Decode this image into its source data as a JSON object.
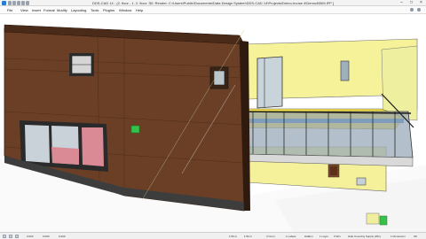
{
  "window": {
    "title": "DDS-CAD 14 - (2. floor - 1. 2. floor: 3D: Render: C:\\Users\\Public\\Documents\\Data Design System\\DDS-CAD 14\\Projects\\Demo-house 4\\Demo4\\BIM.IFP ]"
  },
  "menu": {
    "items": [
      "File",
      "View",
      "Insert",
      "Format",
      "Modify",
      "Layouting",
      "Tools",
      "Plugins",
      "Window",
      "Help"
    ]
  },
  "status": {
    "left": [
      "0.000",
      "0.000",
      "0.000"
    ],
    "mid": [
      "1:50 m",
      "1:50 m",
      "3 Cmm",
      "1 Labels",
      "Hidden",
      "1 Layer",
      "0 Wm"
    ],
    "right": "Hide Covering Supply (Wm)",
    "far_right": [
      "1 Dimension",
      "3D"
    ]
  },
  "colors": {
    "facade_brown": "#6b3f26",
    "facade_light": "#f4f19a",
    "accent_blue": "#2a7bd4",
    "rail_glass": "#8fa1b3",
    "floor_pink": "#d98a95",
    "marker_green": "#34c24a"
  }
}
